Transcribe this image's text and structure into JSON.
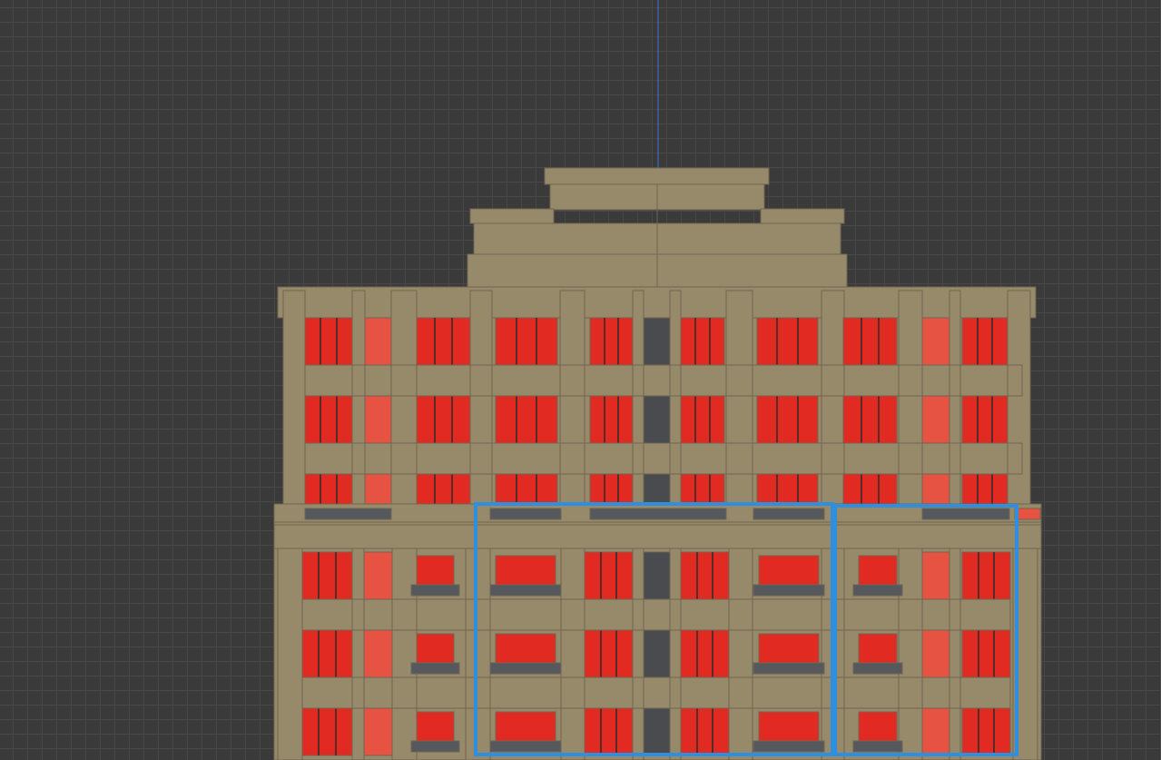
{
  "app": {
    "view": "elevation-drawing-canvas"
  },
  "colors": {
    "canvas_bg": "#3a3a3a",
    "grid_line": "#474747",
    "facade": "#978a6a",
    "facade_outline": "#6f6550",
    "window_glass": "#e02a22",
    "window_glass_light": "#e65342",
    "window_mullion": "#2b2b2b",
    "dark_panel": "#4a4b4e",
    "railing": "#55595e",
    "selection": "#2e8fe0",
    "guide_line": "#3a78c8"
  },
  "selection": {
    "count": 2,
    "label": "selected-window-group"
  },
  "icons": {
    "guide": "vertical-guide-line"
  }
}
